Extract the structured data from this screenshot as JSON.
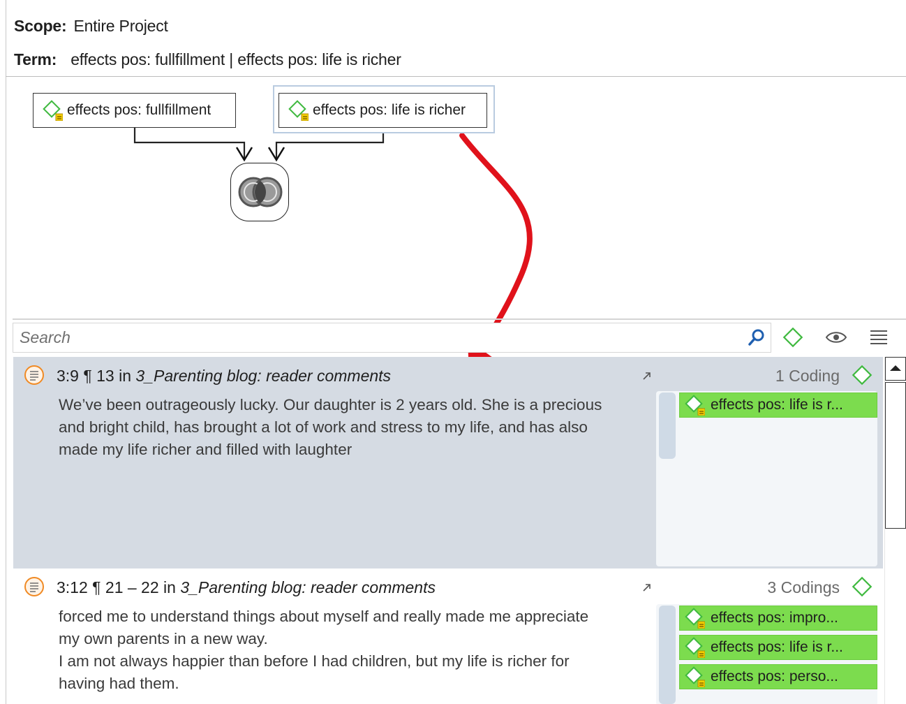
{
  "header": {
    "scope_label": "Scope:",
    "scope_value": "Entire Project",
    "term_label": "Term:",
    "term_value": "effects pos: fullfillment | effects pos: life is richer"
  },
  "diagram": {
    "operand_a": "effects pos: fullfillment",
    "operand_b": "effects pos: life is richer",
    "operator": "intersection-operator-icon"
  },
  "search": {
    "placeholder": "Search"
  },
  "toolbar_icons": [
    "search-icon",
    "code-icon",
    "eye-icon",
    "menu-icon"
  ],
  "results": [
    {
      "ref_id": "3:9",
      "ref_para": "¶ 13",
      "ref_in": "in",
      "source": "3_Parenting blog: reader comments",
      "text_lines": [
        "We’ve been outrageously lucky. Our daughter is 2 years old. She is a precious",
        "and bright child, has brought a lot of work and stress to my life, and has also",
        "made my life richer and filled with laughter"
      ],
      "count_label": "1 Coding",
      "codes": [
        "effects pos: life is r..."
      ]
    },
    {
      "ref_id": "3:12",
      "ref_para": "¶ 21 – 22",
      "ref_in": "in",
      "source": "3_Parenting blog: reader comments",
      "text_lines": [
        "forced me to understand things about myself and really made me appreciate",
        "my own parents in a new way.",
        "I am not always happier than before I had children, but my life is richer for",
        "having had them."
      ],
      "count_label": "3 Codings",
      "codes": [
        "effects pos: impro...",
        "effects pos: life is r...",
        "effects pos: perso..."
      ]
    }
  ],
  "colors": {
    "code_chip": "#7cdc4e",
    "selected_row": "#d5dbe3",
    "arrow": "#e0121b",
    "accent_blue": "#1f5fb0",
    "code_icon_green": "#3fb93f"
  }
}
